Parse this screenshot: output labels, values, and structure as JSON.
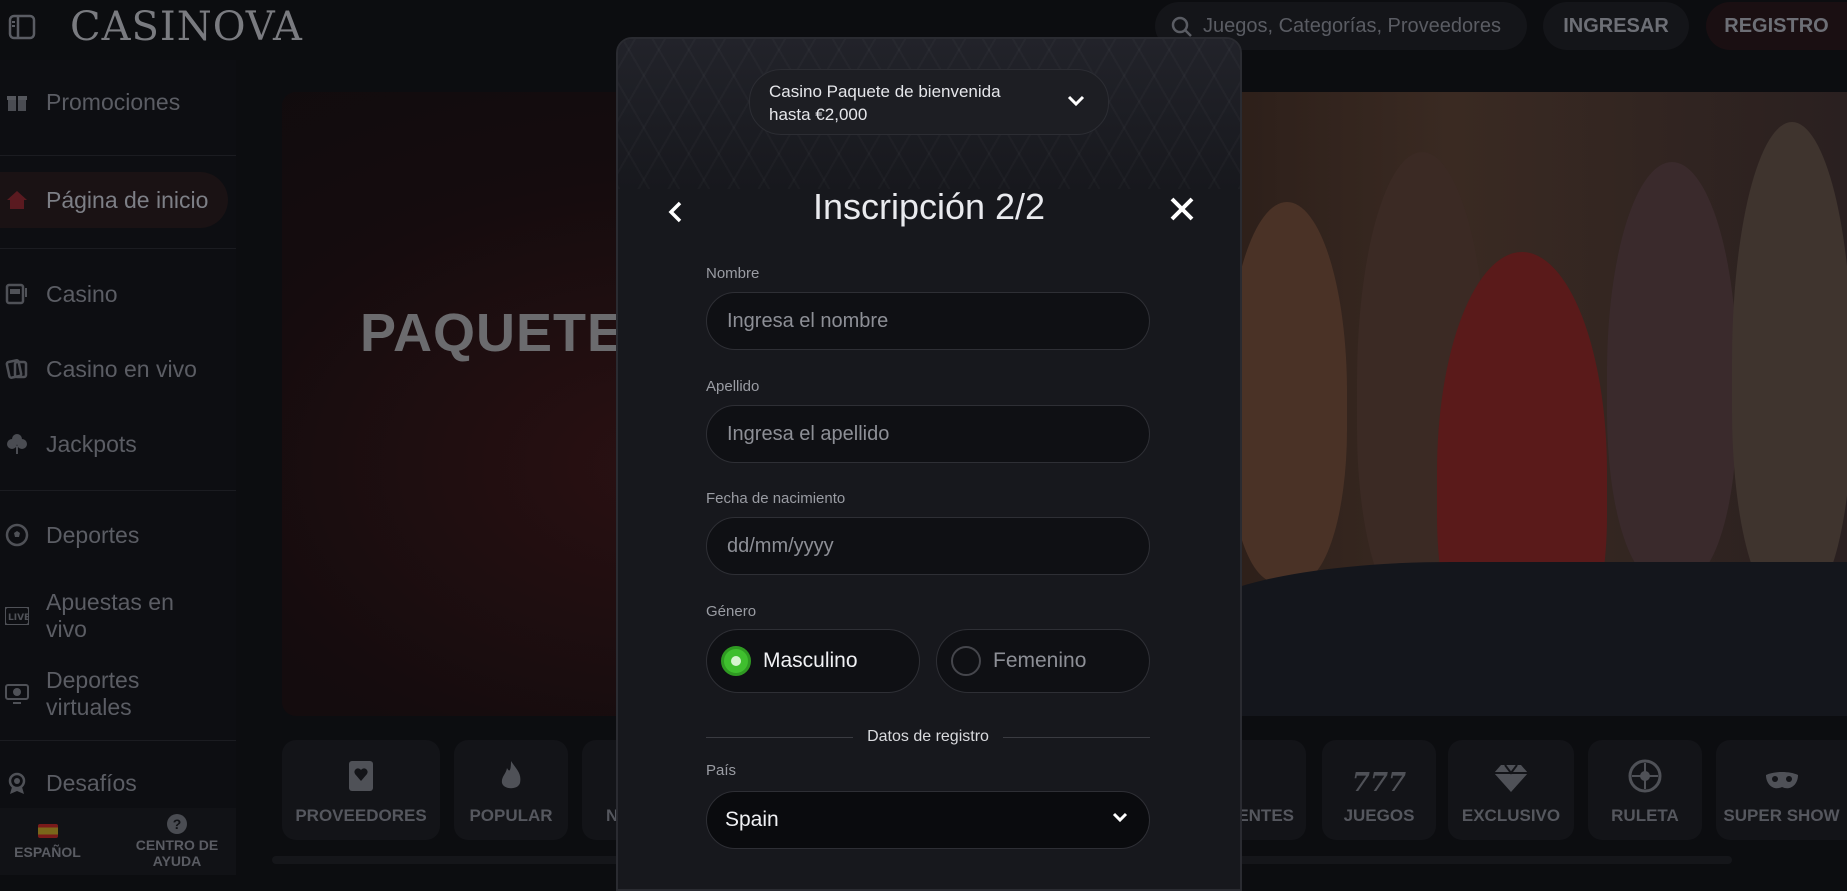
{
  "header": {
    "logo": "CASINOVA",
    "search_placeholder": "Juegos, Categorías, Proveedores",
    "login_label": "INGRESAR",
    "register_label": "REGISTRO"
  },
  "sidebar": {
    "items": [
      {
        "label": "Promociones",
        "icon": "gift-icon"
      },
      {
        "label": "Página de inicio",
        "icon": "home-icon"
      },
      {
        "label": "Casino",
        "icon": "slot-machine-icon"
      },
      {
        "label": "Casino en vivo",
        "icon": "live-casino-icon"
      },
      {
        "label": "Jackpots",
        "icon": "clover-icon"
      },
      {
        "label": "Deportes",
        "icon": "soccer-ball-icon"
      },
      {
        "label": "Apuestas en vivo",
        "icon": "live-icon"
      },
      {
        "label": "Deportes virtuales",
        "icon": "virtual-sports-icon"
      },
      {
        "label": "Desafíos",
        "icon": "medal-icon"
      }
    ],
    "language_label": "ESPAÑOL",
    "help_label": "CENTRO DE AYUDA"
  },
  "hero": {
    "title": "PAQUETE"
  },
  "categories": [
    {
      "label": "PROVEEDORES",
      "icon": "book-heart-icon"
    },
    {
      "label": "POPULAR",
      "icon": "flame-icon"
    },
    {
      "label": "N",
      "icon": ""
    },
    {
      "label": "ENTES",
      "icon": ""
    },
    {
      "label": "JUEGOS",
      "icon": "777-icon"
    },
    {
      "label": "EXCLUSIVO",
      "icon": "diamond-icon"
    },
    {
      "label": "RULETA",
      "icon": "roulette-icon"
    },
    {
      "label": "SUPER SHOW",
      "icon": "mask-icon"
    }
  ],
  "modal": {
    "bonus_text": "Casino Paquete de bienvenida hasta €2,000",
    "title": "Inscripción 2/2",
    "first_name": {
      "label": "Nombre",
      "placeholder": "Ingresa el nombre"
    },
    "last_name": {
      "label": "Apellido",
      "placeholder": "Ingresa el apellido"
    },
    "birth_date": {
      "label": "Fecha de nacimiento",
      "placeholder": "dd/mm/yyyy"
    },
    "gender": {
      "label": "Género",
      "options": [
        "Masculino",
        "Femenino"
      ],
      "selected": "Masculino"
    },
    "section_divider": "Datos de registro",
    "country": {
      "label": "País",
      "value": "Spain"
    }
  },
  "colors": {
    "accent_green": "#3fbf2e",
    "modal_bg": "#17181d",
    "page_bg": "#0c0d10"
  }
}
